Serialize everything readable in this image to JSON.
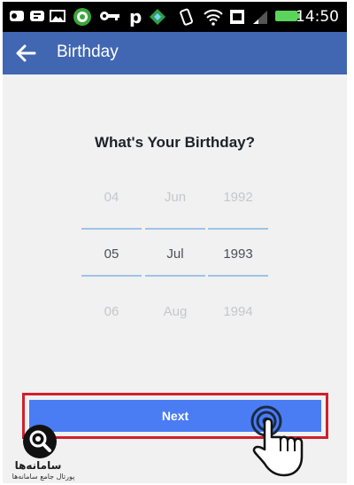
{
  "status_bar": {
    "time": "14:50",
    "icons": [
      "cast-icon",
      "chat-icon",
      "image-icon",
      "badge-icon",
      "key-icon",
      "p-icon",
      "app-icon",
      "rotate-icon",
      "wifi-icon",
      "sim-icon",
      "signal-icon",
      "battery-icon"
    ]
  },
  "app_bar": {
    "back_icon": "arrow-left-icon",
    "title": "Birthday"
  },
  "main": {
    "heading": "What's Your Birthday?",
    "picker": {
      "day": {
        "above": "04",
        "selected": "05",
        "below": "06"
      },
      "month": {
        "above": "Jun",
        "selected": "Jul",
        "below": "Aug"
      },
      "year": {
        "above": "1992",
        "selected": "1993",
        "below": "1994"
      }
    },
    "next_label": "Next"
  },
  "overlay": {
    "highlight_color": "#d0202c",
    "hand_icon": "tap-hand-icon"
  },
  "watermark": {
    "name": "سامانه‌ها",
    "subtitle": "پورتال جامع سامانه‌ها",
    "logo_icon": "magnifier-logo-icon"
  },
  "colors": {
    "app_bar": "#4267b2",
    "button": "#4a7cf3",
    "picker_line": "#9fc3e6"
  }
}
